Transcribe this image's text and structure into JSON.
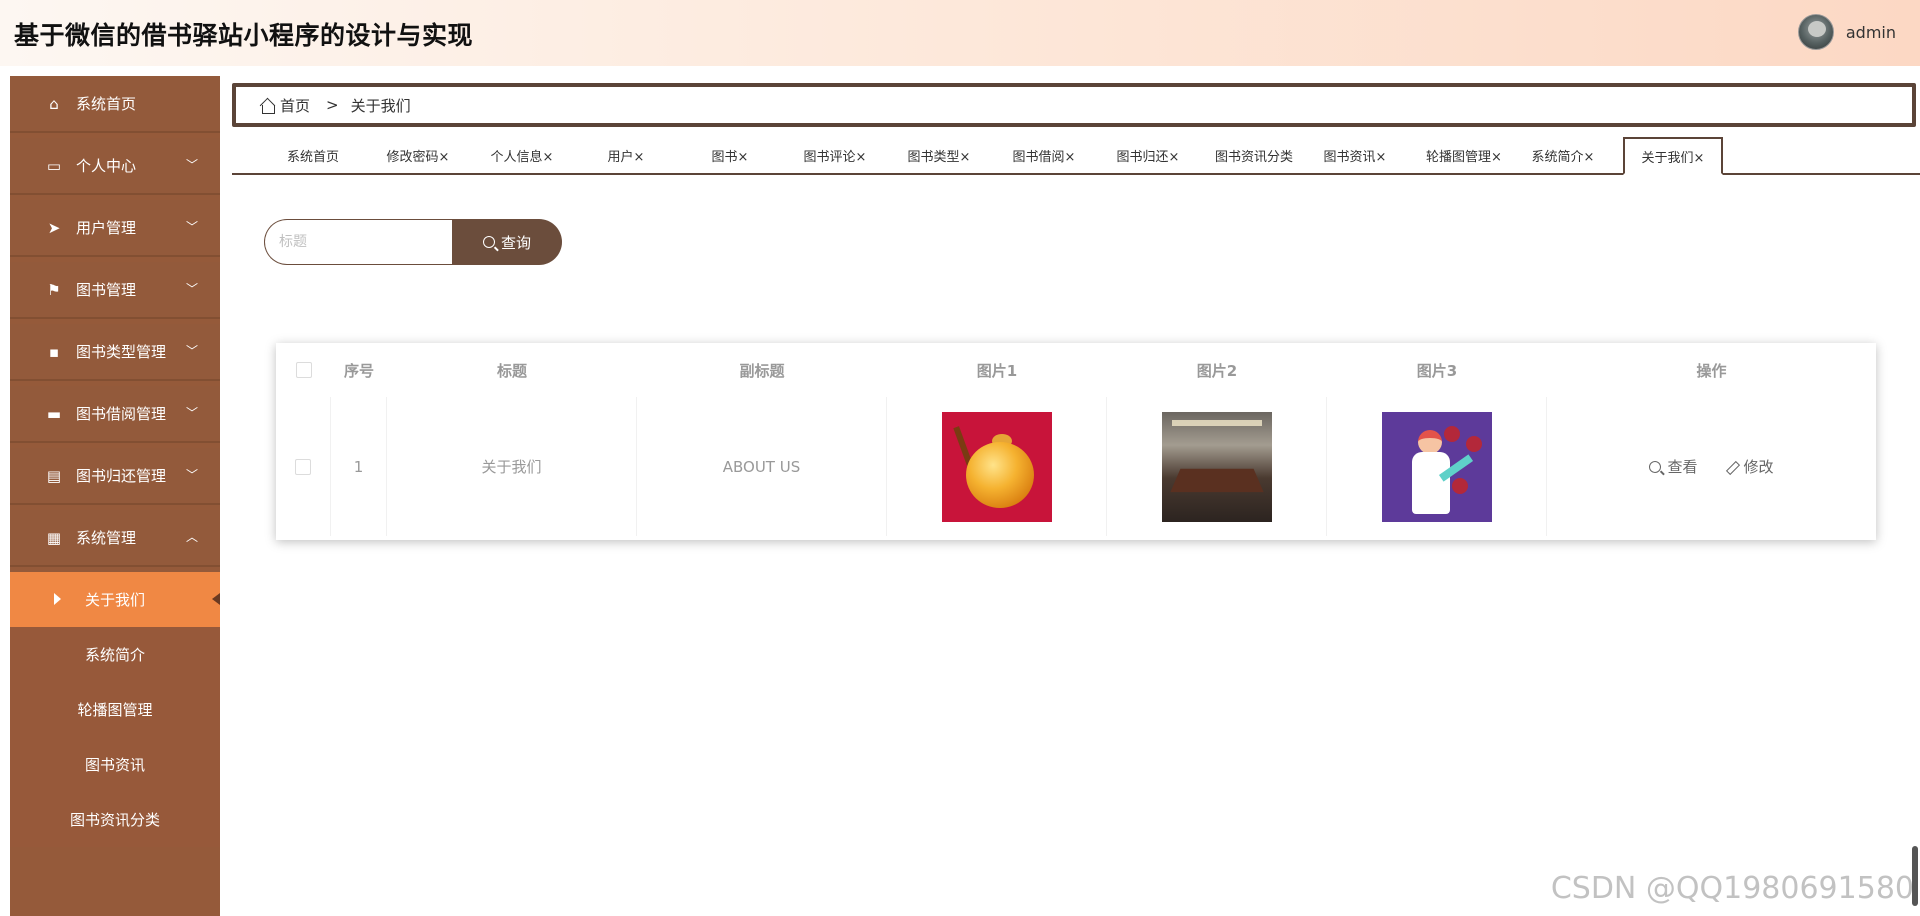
{
  "header": {
    "title": "基于微信的借书驿站小程序的设计与实现",
    "username": "admin"
  },
  "sidebar": {
    "items": [
      {
        "label": "系统首页",
        "icon": "home-icon"
      },
      {
        "label": "个人中心",
        "icon": "card-icon"
      },
      {
        "label": "用户管理",
        "icon": "send-icon"
      },
      {
        "label": "图书管理",
        "icon": "flag-icon"
      },
      {
        "label": "图书类型管理",
        "icon": "chat-icon"
      },
      {
        "label": "图书借阅管理",
        "icon": "ticket-icon"
      },
      {
        "label": "图书归还管理",
        "icon": "clipboard-icon"
      },
      {
        "label": "系统管理",
        "icon": "grid-icon"
      }
    ],
    "sub_items": [
      "关于我们",
      "系统简介",
      "轮播图管理",
      "图书资讯",
      "图书资讯分类"
    ]
  },
  "breadcrumb": {
    "home": "首页",
    "separator": ">",
    "current": "关于我们"
  },
  "tabs": [
    {
      "label": "系统首页"
    },
    {
      "label": "修改密码×"
    },
    {
      "label": "个人信息×"
    },
    {
      "label": "用户×"
    },
    {
      "label": "图书×"
    },
    {
      "label": "图书评论×"
    },
    {
      "label": "图书类型×"
    },
    {
      "label": "图书借阅×"
    },
    {
      "label": "图书归还×"
    },
    {
      "label": "图书资讯分类"
    },
    {
      "label": "图书资讯×"
    },
    {
      "label": "轮播图管理×"
    },
    {
      "label": "系统简介×"
    },
    {
      "label": "关于我们×"
    }
  ],
  "search": {
    "placeholder": "标题",
    "button_label": "查询"
  },
  "table": {
    "columns": [
      "序号",
      "标题",
      "副标题",
      "图片1",
      "图片2",
      "图片3",
      "操作"
    ],
    "rows": [
      {
        "index": "1",
        "title": "关于我们",
        "subtitle": "ABOUT US"
      }
    ],
    "actions": {
      "view": "查看",
      "edit": "修改"
    }
  },
  "watermark": "CSDN @QQ1980691580"
}
